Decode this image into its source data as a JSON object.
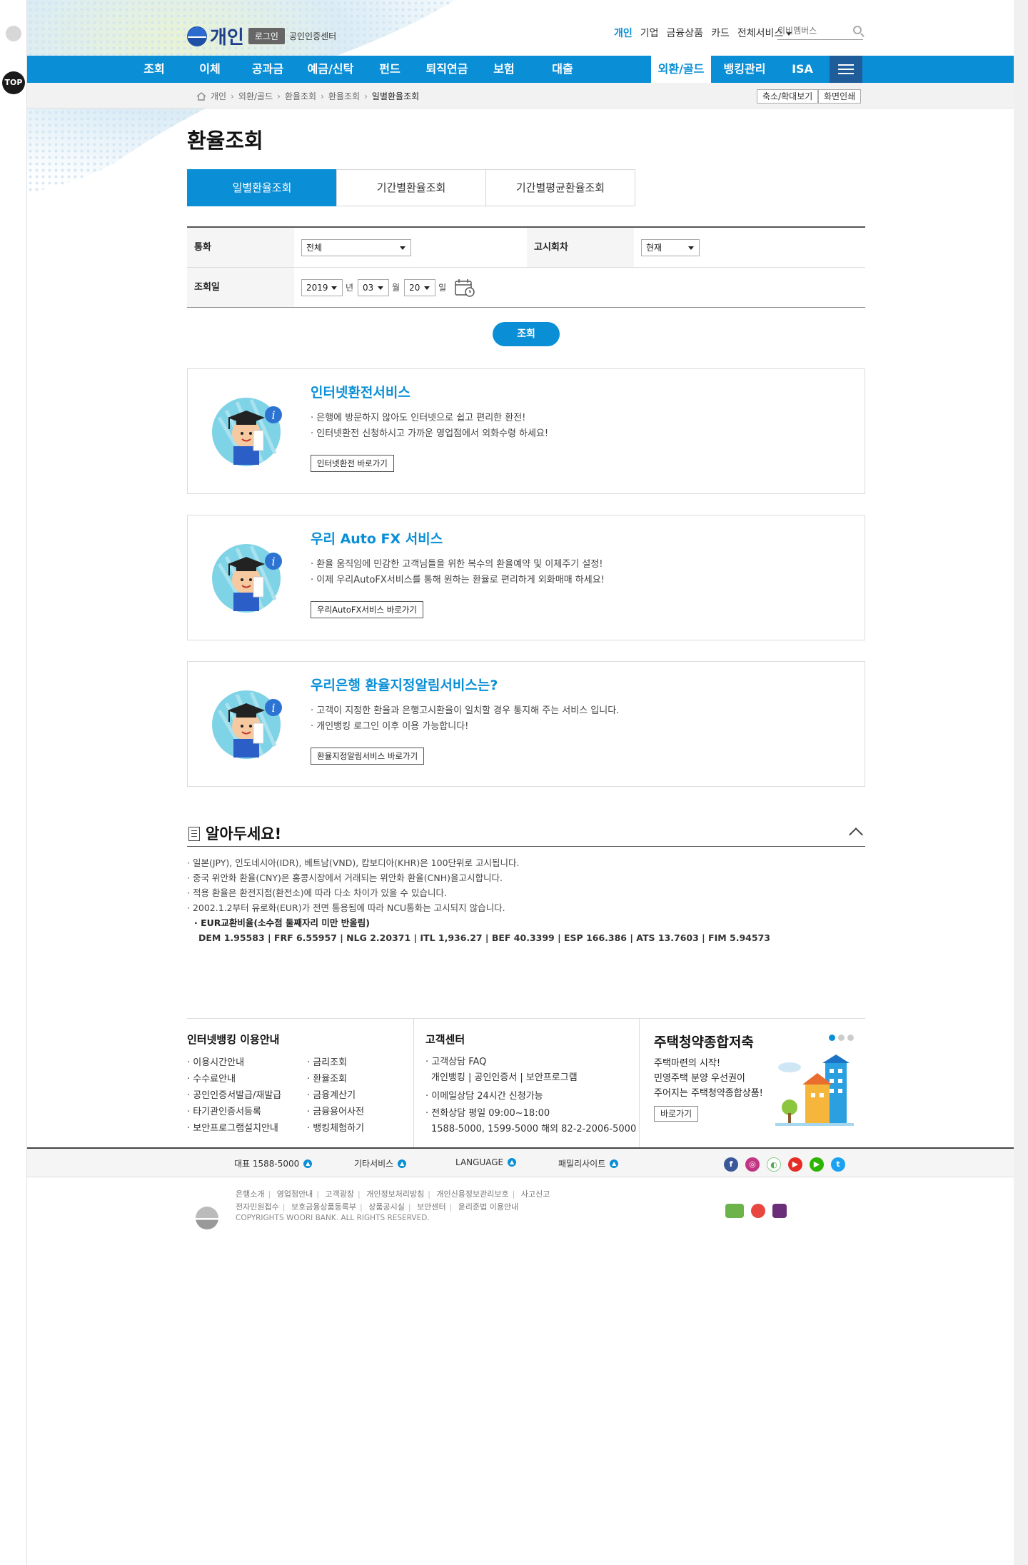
{
  "side": {
    "top_label": "TOP"
  },
  "header": {
    "logo_text": "개인",
    "login_label": "로그인",
    "cert_label": "공인인증센터",
    "util_nav": [
      "개인",
      "기업",
      "금융상품",
      "카드",
      "전체서비스"
    ],
    "search_placeholder": "위비멤버스"
  },
  "gnb": [
    "조회",
    "이체",
    "공과금",
    "예금/신탁",
    "펀드",
    "퇴직연금",
    "보험",
    "대출",
    "외환/골드",
    "뱅킹관리",
    "ISA"
  ],
  "breadcrumb": [
    "개인",
    "외환/골드",
    "환율조회",
    "환율조회",
    "일별환율조회"
  ],
  "lnb_buttons": {
    "zoom": "축소/확대보기",
    "print": "화면인쇄"
  },
  "page_title": "환율조회",
  "tabs": [
    "일별환율조회",
    "기간별환율조회",
    "기간별평균환율조회"
  ],
  "form": {
    "currency_label": "통화",
    "currency_value": "전체",
    "notice_label": "고시회차",
    "notice_value": "현재",
    "date_label": "조회일",
    "year": "2019",
    "year_unit": "년",
    "month": "03",
    "month_unit": "월",
    "day": "20",
    "day_unit": "일",
    "submit_label": "조회"
  },
  "services": [
    {
      "title": "인터넷환전서비스",
      "lines": [
        "은행에 방문하지 않아도 인터넷으로 쉽고 편리한 환전!",
        "인터넷환전 신청하시고 가까운 영업점에서 외화수령 하세요!"
      ],
      "button": "인터넷환전 바로가기"
    },
    {
      "title": "우리 Auto FX 서비스",
      "lines": [
        "환율 움직임에 민감한 고객님들을 위한 복수의 환율예약 및 이체주기 설정!",
        "이제 우리AutoFX서비스를 통해 원하는 환율로 편리하게 외화매매 하세요!"
      ],
      "button": "우리AutoFX서비스 바로가기"
    },
    {
      "title": "우리은행 환율지정알림서비스는?",
      "lines": [
        "고객이 지정한 환율과 은행고시환율이 일치할 경우 통지해 주는 서비스 입니다.",
        "개인뱅킹 로그인 이후 이용 가능합니다!"
      ],
      "button": "환율지정알림서비스 바로가기"
    }
  ],
  "notice": {
    "title": "알아두세요!",
    "items": [
      "일본(JPY), 인도네시아(IDR), 베트남(VND), 캄보디아(KHR)은 100단위로 고시됩니다.",
      "중국 위안화 환율(CNY)은 홍콩시장에서 거래되는 위안화 환율(CNH)을고시합니다.",
      "적용 환율은 환전지점(환전소)에 따라 다소 차이가 있을 수 있습니다.",
      "2002.1.2부터 유로화(EUR)가 전면 통용됨에 따라 NCU통화는 고시되지 않습니다."
    ],
    "eur_heading": "EUR교환비율(소수점 둘째자리 미만 반올림)",
    "eur_rates": "DEM 1.95583  |  FRF 6.55957  |  NLG 2.20371  |  ITL 1,936.27  |  BEF 40.3399  |  ESP 166.386  |  ATS 13.7603  |  FIM 5.94573"
  },
  "footer_info": {
    "banking_title": "인터넷뱅킹 이용안내",
    "banking_left": [
      "이용시간안내",
      "수수료안내",
      "공인인증서발급/재발급",
      "타기관인증서등록",
      "보안프로그램설치안내"
    ],
    "banking_right": [
      "금리조회",
      "환율조회",
      "금융계산기",
      "금융용어사전",
      "뱅킹체험하기"
    ],
    "cs_title": "고객센터",
    "cs_faq": "고객상담 FAQ",
    "cs_faq_sub": "개인뱅킹 | 공인인증서 | 보안프로그램",
    "cs_email": "이메일상담 24시간 신청가능",
    "cs_phone": "전화상담 평일 09:00~18:00",
    "cs_phone_sub": "1588-5000, 1599-5000 해외 82-2-2006-5000",
    "promo_title": "주택청약종합저축",
    "promo_lines": [
      "주택마련의 시작!",
      "민영주택 분양 우선권이",
      "주어지는 주택청약종합상품!"
    ],
    "promo_button": "바로가기"
  },
  "footer_bar": {
    "rep": "대표 1588-5000",
    "other": "기타서비스",
    "language": "LANGUAGE",
    "family": "패밀리사이트"
  },
  "footer_links": {
    "row1": [
      "은행소개",
      "영업점안내",
      "고객광장",
      "개인정보처리방침",
      "개인신용정보관리보호",
      "사고신고"
    ],
    "row2": [
      "전자민원접수",
      "보호금융상품등록부",
      "상품공시실",
      "보안센터",
      "윤리준법 이용안내"
    ],
    "copyright": "COPYRIGHTS WOORI BANK. ALL RIGHTS RESERVED."
  },
  "colors": {
    "accent": "#0a8fd7",
    "menu_dark": "#1f5d9a"
  }
}
